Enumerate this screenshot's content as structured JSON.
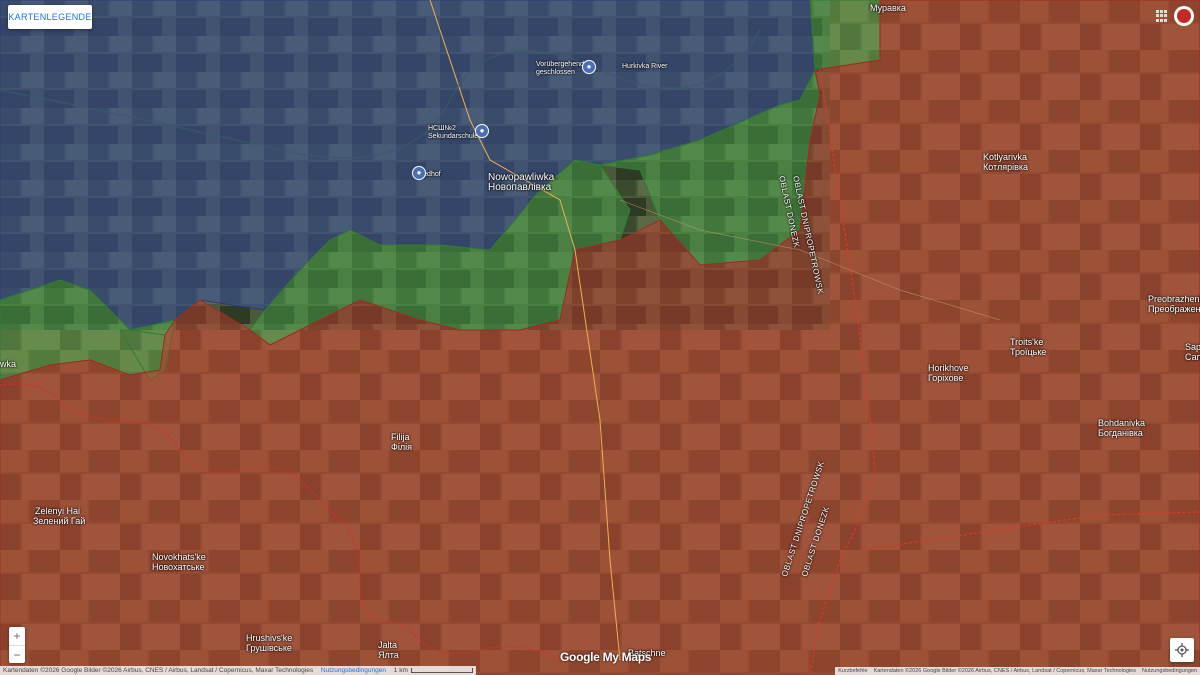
{
  "map": {
    "legend_button": "KARTENLEGENDE",
    "places": [
      {
        "id": "muravka",
        "name": "Муравка"
      },
      {
        "id": "vorubergehend",
        "name": "Vorübergehend geschlossen"
      },
      {
        "id": "river",
        "name": "Hurkivka River"
      },
      {
        "id": "school",
        "name": "НСШ№2 Sekundarschule"
      },
      {
        "id": "friedhof",
        "name": "Friedhof"
      },
      {
        "id": "nowopawliwka",
        "name": "Nowopawliwka"
      },
      {
        "id": "novopavlivka_cyr",
        "name": "Новопавлівка"
      },
      {
        "id": "kotlyarivka",
        "name": "Kotlyarivka"
      },
      {
        "id": "kotlyarivka_cyr",
        "name": "Котлярівка"
      },
      {
        "id": "preobrazhenka",
        "name": "Preobrazhenk"
      },
      {
        "id": "preobrazhenka_cyr",
        "name": "Преображен"
      },
      {
        "id": "troitske",
        "name": "Troits'ke"
      },
      {
        "id": "troitske_cyr",
        "name": "Троїцьке"
      },
      {
        "id": "horikhove",
        "name": "Horikhove"
      },
      {
        "id": "horikhove_cyr",
        "name": "Горіхове"
      },
      {
        "id": "bohdanivka",
        "name": "Bohdanivka"
      },
      {
        "id": "bohdanivka_cyr",
        "name": "Богданівка"
      },
      {
        "id": "filija",
        "name": "Filija"
      },
      {
        "id": "filija_cyr",
        "name": "Філія"
      },
      {
        "id": "zelenyi",
        "name": "Zelenyi Hai"
      },
      {
        "id": "zelenyi_cyr",
        "name": "Зелений Гай"
      },
      {
        "id": "novokhatske",
        "name": "Novokhats'ke"
      },
      {
        "id": "novokhatske_cyr",
        "name": "Новохатське"
      },
      {
        "id": "hrushivske",
        "name": "Hrushivs'ke"
      },
      {
        "id": "hrushivske_cyr",
        "name": "Грушівське"
      },
      {
        "id": "jalta",
        "name": "Jalta"
      },
      {
        "id": "jalta_cyr",
        "name": "Ялта"
      },
      {
        "id": "sap",
        "name": "Sap"
      },
      {
        "id": "sap_cyr",
        "name": "Сап"
      },
      {
        "id": "batschne",
        "name": "Batschne"
      },
      {
        "id": "vka",
        "name": "wka"
      }
    ],
    "border_labels": {
      "donezk_top": "OBLAST DONEZK",
      "dnipro_top": "OBLAST DNIPROPETROWSK",
      "dnipro_bottom": "OBLAST DNIPROPETROWSK",
      "donezk_bottom": "OBLAST DONEZK"
    },
    "google_logo": "Google My Maps",
    "attribution": "Kartendaten ©2026 Google Bilder ©2026 Airbus, CNES / Airbus, Landsat / Copernicus, Maxar Technologies",
    "terms_link": "Nutzungsbedingungen",
    "scale_label": "1 km",
    "attribution_right": {
      "shortcuts": "Kurzbefehle",
      "data": "Kartendaten ©2026 Google Bilder ©2026 Airbus, CNES / Airbus, Landsat / Copernicus, Maxar Technologies",
      "terms": "Nutzungsbedingungen"
    },
    "zoom_in": "+",
    "zoom_out": "−",
    "colors": {
      "russian_control": "#c0392b",
      "ukrainian_control": "#3a4fa0",
      "contested": "#4caf50"
    }
  }
}
